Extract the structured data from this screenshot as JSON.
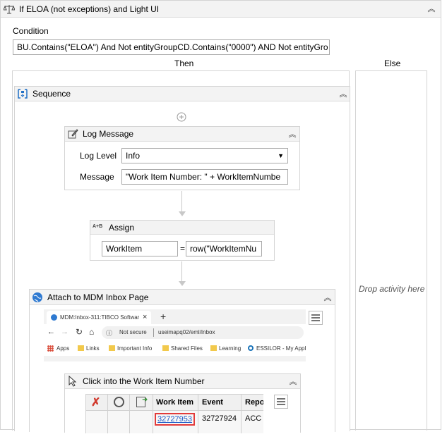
{
  "if_activity": {
    "title": "If ELOA (not exceptions) and Light UI",
    "condition_label": "Condition",
    "condition_value": "BU.Contains(\"ELOA\") And Not entityGroupCD.Contains(\"0000\") AND Not entityGro",
    "then_label": "Then",
    "else_label": "Else",
    "else_drop_hint": "Drop activity here"
  },
  "sequence": {
    "title": "Sequence"
  },
  "log_message": {
    "title": "Log Message",
    "level_label": "Log Level",
    "level_value": "Info",
    "message_label": "Message",
    "message_value": "\"Work Item Number: \" + WorkItemNumbe"
  },
  "assign": {
    "badge": "A+B",
    "title": "Assign",
    "to_value": "WorkItem",
    "equals": "=",
    "value_value": "row(\"WorkItemNu"
  },
  "attach": {
    "title": "Attach to MDM Inbox Page",
    "browser": {
      "tab_title": "MDM:Inbox-311:TIBCO Software",
      "tab_close": "×",
      "new_tab": "+",
      "not_secure": "Not secure",
      "url": "useimapq02/eml/Inbox",
      "bookmarks": [
        "Apps",
        "Links",
        "Important Info",
        "Shared Files",
        "Learning",
        "ESSILOR - My Appl"
      ]
    }
  },
  "click": {
    "title": "Click into the Work Item Number",
    "table": {
      "headers": [
        "Work Item",
        "Event",
        "Repo"
      ],
      "row": [
        "32727953",
        "32727924",
        "ACC"
      ]
    }
  },
  "icons": {
    "collapse": "chevron-double-up",
    "add": "plus-circle",
    "menu": "hamburger"
  }
}
